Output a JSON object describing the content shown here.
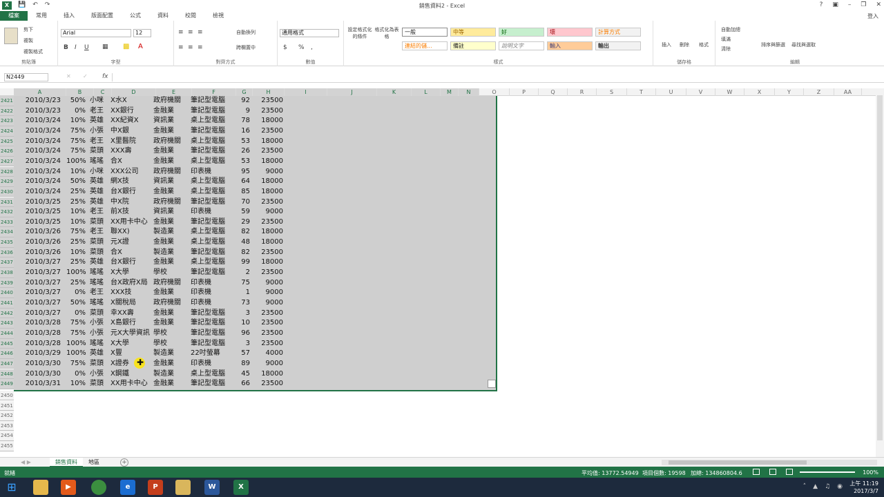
{
  "window": {
    "title": "銷售資料2 - Excel",
    "help": "?",
    "login": "登入",
    "app_icon": "X",
    "qat": [
      "save-icon",
      "undo-icon",
      "redo-icon"
    ]
  },
  "ribbon_tabs": [
    "檔案",
    "常用",
    "插入",
    "版面配置",
    "公式",
    "資料",
    "校閱",
    "檢視"
  ],
  "active_tab": "檔案",
  "ribbon": {
    "clipboard": {
      "label": "剪貼簿",
      "cut": "剪下",
      "copy": "複製",
      "format_painter": "複製格式"
    },
    "font": {
      "label": "字型",
      "name": "Arial",
      "size": "12",
      "bold": "B",
      "italic": "I",
      "underline": "U"
    },
    "alignment": {
      "label": "對齊方式",
      "wrap": "自動換列",
      "merge": "跨欄置中"
    },
    "number": {
      "label": "數值",
      "format": "通用格式",
      "currency": "$",
      "percent": "%",
      "comma": ","
    },
    "styles": {
      "label": "樣式",
      "cond_fmt": "設定格式化的條件",
      "table_fmt": "格式化為表格",
      "cells": [
        "一般",
        "中等",
        "好",
        "壞",
        "計算方式",
        "連結的儲...",
        "備註",
        "說明文字",
        "輸入",
        "輸出"
      ]
    },
    "cells": {
      "label": "儲存格",
      "insert": "插入",
      "delete": "刪除",
      "format": "格式"
    },
    "editing": {
      "label": "編輯",
      "autosum": "自動加總",
      "fill": "填滿",
      "clear": "清除",
      "sort": "排序與篩選",
      "find": "尋找與選取"
    }
  },
  "formula_bar": {
    "name_box": "N2449",
    "fx": "fx",
    "cancel": "✕",
    "confirm": "✓",
    "value": ""
  },
  "columns": [
    "A",
    "B",
    "C",
    "D",
    "E",
    "F",
    "G",
    "H",
    "I",
    "J",
    "K",
    "L",
    "M",
    "N",
    "O",
    "P",
    "Q",
    "R",
    "S",
    "T",
    "U",
    "V",
    "W",
    "X",
    "Y",
    "Z",
    "AA"
  ],
  "rows": [
    {
      "n": "2421",
      "date": "2010/3/23",
      "pct": "50%",
      "who": "小咪",
      "cust": "X水X",
      "ind": "政府機關",
      "prod": "筆記型電腦",
      "qty": "92",
      "price": "23500"
    },
    {
      "n": "2422",
      "date": "2010/3/23",
      "pct": "0%",
      "who": "老王",
      "cust": "XX銀行",
      "ind": "金融業",
      "prod": "筆記型電腦",
      "qty": "9",
      "price": "23500"
    },
    {
      "n": "2423",
      "date": "2010/3/24",
      "pct": "10%",
      "who": "英雄",
      "cust": "XX紀資X",
      "ind": "資訊業",
      "prod": "桌上型電腦",
      "qty": "78",
      "price": "18000"
    },
    {
      "n": "2424",
      "date": "2010/3/24",
      "pct": "75%",
      "who": "小張",
      "cust": "中X銀",
      "ind": "金融業",
      "prod": "筆記型電腦",
      "qty": "16",
      "price": "23500"
    },
    {
      "n": "2425",
      "date": "2010/3/24",
      "pct": "75%",
      "who": "老王",
      "cust": "X里醫院",
      "ind": "政府機關",
      "prod": "桌上型電腦",
      "qty": "53",
      "price": "18000"
    },
    {
      "n": "2426",
      "date": "2010/3/24",
      "pct": "75%",
      "who": "菜頭",
      "cust": "XXX壽",
      "ind": "金融業",
      "prod": "筆記型電腦",
      "qty": "26",
      "price": "23500"
    },
    {
      "n": "2427",
      "date": "2010/3/24",
      "pct": "100%",
      "who": "瑤瑤",
      "cust": "合X",
      "ind": "金融業",
      "prod": "桌上型電腦",
      "qty": "53",
      "price": "18000"
    },
    {
      "n": "2428",
      "date": "2010/3/24",
      "pct": "10%",
      "who": "小咪",
      "cust": "XXX公司",
      "ind": "政府機關",
      "prod": "印表機",
      "qty": "95",
      "price": "9000"
    },
    {
      "n": "2429",
      "date": "2010/3/24",
      "pct": "50%",
      "who": "英雄",
      "cust": "網X技",
      "ind": "資訊業",
      "prod": "桌上型電腦",
      "qty": "64",
      "price": "18000"
    },
    {
      "n": "2430",
      "date": "2010/3/24",
      "pct": "25%",
      "who": "英雄",
      "cust": "台X銀行",
      "ind": "金融業",
      "prod": "桌上型電腦",
      "qty": "85",
      "price": "18000"
    },
    {
      "n": "2431",
      "date": "2010/3/25",
      "pct": "25%",
      "who": "英雄",
      "cust": "中X院",
      "ind": "政府機關",
      "prod": "筆記型電腦",
      "qty": "70",
      "price": "23500"
    },
    {
      "n": "2432",
      "date": "2010/3/25",
      "pct": "10%",
      "who": "老王",
      "cust": "前X技",
      "ind": "資訊業",
      "prod": "印表機",
      "qty": "59",
      "price": "9000"
    },
    {
      "n": "2433",
      "date": "2010/3/25",
      "pct": "10%",
      "who": "菜頭",
      "cust": "XX用卡中心",
      "ind": "金融業",
      "prod": "筆記型電腦",
      "qty": "29",
      "price": "23500"
    },
    {
      "n": "2434",
      "date": "2010/3/26",
      "pct": "75%",
      "who": "老王",
      "cust": "聯XX)",
      "ind": "製造業",
      "prod": "桌上型電腦",
      "qty": "82",
      "price": "18000"
    },
    {
      "n": "2435",
      "date": "2010/3/26",
      "pct": "25%",
      "who": "菜頭",
      "cust": "元X證",
      "ind": "金融業",
      "prod": "桌上型電腦",
      "qty": "48",
      "price": "18000"
    },
    {
      "n": "2436",
      "date": "2010/3/26",
      "pct": "10%",
      "who": "菜頭",
      "cust": "合X",
      "ind": "製造業",
      "prod": "筆記型電腦",
      "qty": "82",
      "price": "23500"
    },
    {
      "n": "2437",
      "date": "2010/3/27",
      "pct": "25%",
      "who": "英雄",
      "cust": "台X銀行",
      "ind": "金融業",
      "prod": "桌上型電腦",
      "qty": "99",
      "price": "18000"
    },
    {
      "n": "2438",
      "date": "2010/3/27",
      "pct": "100%",
      "who": "瑤瑤",
      "cust": "X大學",
      "ind": "學校",
      "prod": "筆記型電腦",
      "qty": "2",
      "price": "23500"
    },
    {
      "n": "2439",
      "date": "2010/3/27",
      "pct": "25%",
      "who": "瑤瑤",
      "cust": "台X政府X局",
      "ind": "政府機關",
      "prod": "印表機",
      "qty": "75",
      "price": "9000"
    },
    {
      "n": "2440",
      "date": "2010/3/27",
      "pct": "0%",
      "who": "老王",
      "cust": "XXX技",
      "ind": "金融業",
      "prod": "印表機",
      "qty": "1",
      "price": "9000"
    },
    {
      "n": "2441",
      "date": "2010/3/27",
      "pct": "50%",
      "who": "瑤瑤",
      "cust": "X關稅局",
      "ind": "政府機關",
      "prod": "印表機",
      "qty": "73",
      "price": "9000"
    },
    {
      "n": "2442",
      "date": "2010/3/27",
      "pct": "0%",
      "who": "菜頭",
      "cust": "幸XX壽",
      "ind": "金融業",
      "prod": "筆記型電腦",
      "qty": "3",
      "price": "23500"
    },
    {
      "n": "2443",
      "date": "2010/3/28",
      "pct": "75%",
      "who": "小張",
      "cust": "X島銀行",
      "ind": "金融業",
      "prod": "筆記型電腦",
      "qty": "10",
      "price": "23500"
    },
    {
      "n": "2444",
      "date": "2010/3/28",
      "pct": "75%",
      "who": "小張",
      "cust": "元X大學資訊",
      "ind": "學校",
      "prod": "筆記型電腦",
      "qty": "96",
      "price": "23500"
    },
    {
      "n": "2445",
      "date": "2010/3/28",
      "pct": "100%",
      "who": "瑤瑤",
      "cust": "X大學",
      "ind": "學校",
      "prod": "筆記型電腦",
      "qty": "3",
      "price": "23500"
    },
    {
      "n": "2446",
      "date": "2010/3/29",
      "pct": "100%",
      "who": "英雄",
      "cust": "X豐",
      "ind": "製造業",
      "prod": "22吋螢幕",
      "qty": "57",
      "price": "4000"
    },
    {
      "n": "2447",
      "date": "2010/3/30",
      "pct": "75%",
      "who": "菜頭",
      "cust": "X證券",
      "ind": "金融業",
      "prod": "印表機",
      "qty": "89",
      "price": "9000"
    },
    {
      "n": "2448",
      "date": "2010/3/30",
      "pct": "0%",
      "who": "小張",
      "cust": "X鋼鐵",
      "ind": "製造業",
      "prod": "桌上型電腦",
      "qty": "45",
      "price": "18000"
    },
    {
      "n": "2449",
      "date": "2010/3/31",
      "pct": "10%",
      "who": "菜頭",
      "cust": "XX用卡中心",
      "ind": "金融業",
      "prod": "筆記型電腦",
      "qty": "66",
      "price": "23500"
    }
  ],
  "empty_rows": [
    "2450",
    "2451",
    "2452",
    "2453",
    "2454",
    "2455"
  ],
  "sheets": [
    "銷售資料",
    "地區"
  ],
  "active_sheet": "銷售資料",
  "status": {
    "mode": "就緒",
    "average": "平均值: 13772.54949",
    "count": "項目個數: 19598",
    "sum": "加總: 134860804.6",
    "zoom": "100%"
  },
  "taskbar": {
    "time": "上午 11:19",
    "date": "2017/3/7"
  }
}
